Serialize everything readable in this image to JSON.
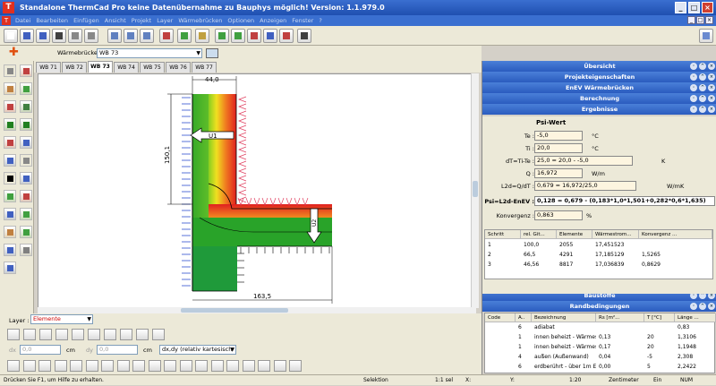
{
  "window": {
    "title": "Standalone ThermCad Pro  keine Datenübernahme zu Bauphys möglich! Version: 1.1.979.0"
  },
  "menu": [
    "Datei",
    "Bearbeiten",
    "Einfügen",
    "Ansicht",
    "Projekt",
    "Layer",
    "Wärmebrücken",
    "Optionen",
    "Anzeigen",
    "Fenster",
    "?"
  ],
  "wb": {
    "label": "Wärmebrücke :",
    "value": "WB 73"
  },
  "tabs": [
    "WB 71",
    "WB 72",
    "WB 73",
    "WB 74",
    "WB 75",
    "WB 76",
    "WB 77"
  ],
  "active_tab": 2,
  "drawing": {
    "dim_top": "44,0",
    "dim_left": "150,1",
    "dim_bottom": "163,5",
    "arrow_u1": "U1",
    "arrow_u2": "U2"
  },
  "panel": {
    "sections": [
      "Übersicht",
      "Projekteigenschaften",
      "EnEV Wärmebrücken",
      "Berechnung",
      "Ergebnisse",
      "Baustoffe",
      "Randbedingungen"
    ],
    "psi_title": "Psi-Wert",
    "rows": [
      {
        "label": "Te :",
        "value": "-5,0",
        "unit": "°C"
      },
      {
        "label": "Ti :",
        "value": "20,0",
        "unit": "°C"
      },
      {
        "label": "dT=Ti-Te :",
        "value": "25,0 = 20,0 - -5,0",
        "unit": "K"
      },
      {
        "label": "Q :",
        "value": "16,972",
        "unit": "W/m"
      },
      {
        "label": "L2d=Q/dT :",
        "value": "0,679 = 16,972/25,0",
        "unit": "W/mK"
      }
    ],
    "psi": {
      "label": "Psi=L2d-EnEV :",
      "value": "0,128 = 0,679 - (0,183*1,0*1,501+0,282*0,6*1,635)"
    },
    "konv": {
      "label": "Konvergenz :",
      "value": "0,863",
      "unit": "%"
    },
    "result_table": {
      "headers": [
        "Schritt",
        "rel. Git...",
        "Elemente",
        "Wärmestrom...",
        "Konvergenz ..."
      ],
      "rows": [
        [
          "1",
          "100,0",
          "2055",
          "17,451523",
          ""
        ],
        [
          "2",
          "66,5",
          "4291",
          "17,185129",
          "1,5265"
        ],
        [
          "3",
          "46,56",
          "8817",
          "17,036839",
          "0,8629"
        ]
      ]
    },
    "rand_table": {
      "headers": [
        "Code",
        "A..",
        "Bezeichnung",
        "Rs [m²...",
        "T [°C]",
        "Länge ..."
      ],
      "rows": [
        [
          "",
          "6",
          "adiabat",
          "",
          "",
          "0,83"
        ],
        [
          "",
          "1",
          "innen beheizt - Wärmestro...",
          "0,13",
          "20",
          "1,3106"
        ],
        [
          "",
          "1",
          "innen beheizt - Wärmestro...",
          "0,17",
          "20",
          "1,1948"
        ],
        [
          "",
          "4",
          "außen (Außenwand)",
          "0,04",
          "-5",
          "2,308"
        ],
        [
          "",
          "6",
          "erdberührt - über 1m Erdr...",
          "0,00",
          "5",
          "2,2422"
        ]
      ]
    }
  },
  "bottom": {
    "layer_label": "Layer :",
    "layer_value": "Elemente",
    "dx_label": "dx",
    "dy_label": "dy",
    "dx": "0,0",
    "dy": "0,0",
    "dx2": "0,0",
    "dy2": "0,0",
    "unit": "cm",
    "mode": "dx,dy (relativ kartesisch"
  },
  "status": {
    "hint": "Drücken Sie F1, um Hilfe zu erhalten.",
    "mode": "Selektion",
    "scale": "1:1 sel",
    "x": "X:",
    "y": "Y:",
    "ratio": "1:20",
    "unit": "Zentimeter",
    "ein": "Ein",
    "num": "NUM"
  },
  "colors": {
    "title": "#2a5bbf",
    "accent": "#3a6fd0"
  }
}
